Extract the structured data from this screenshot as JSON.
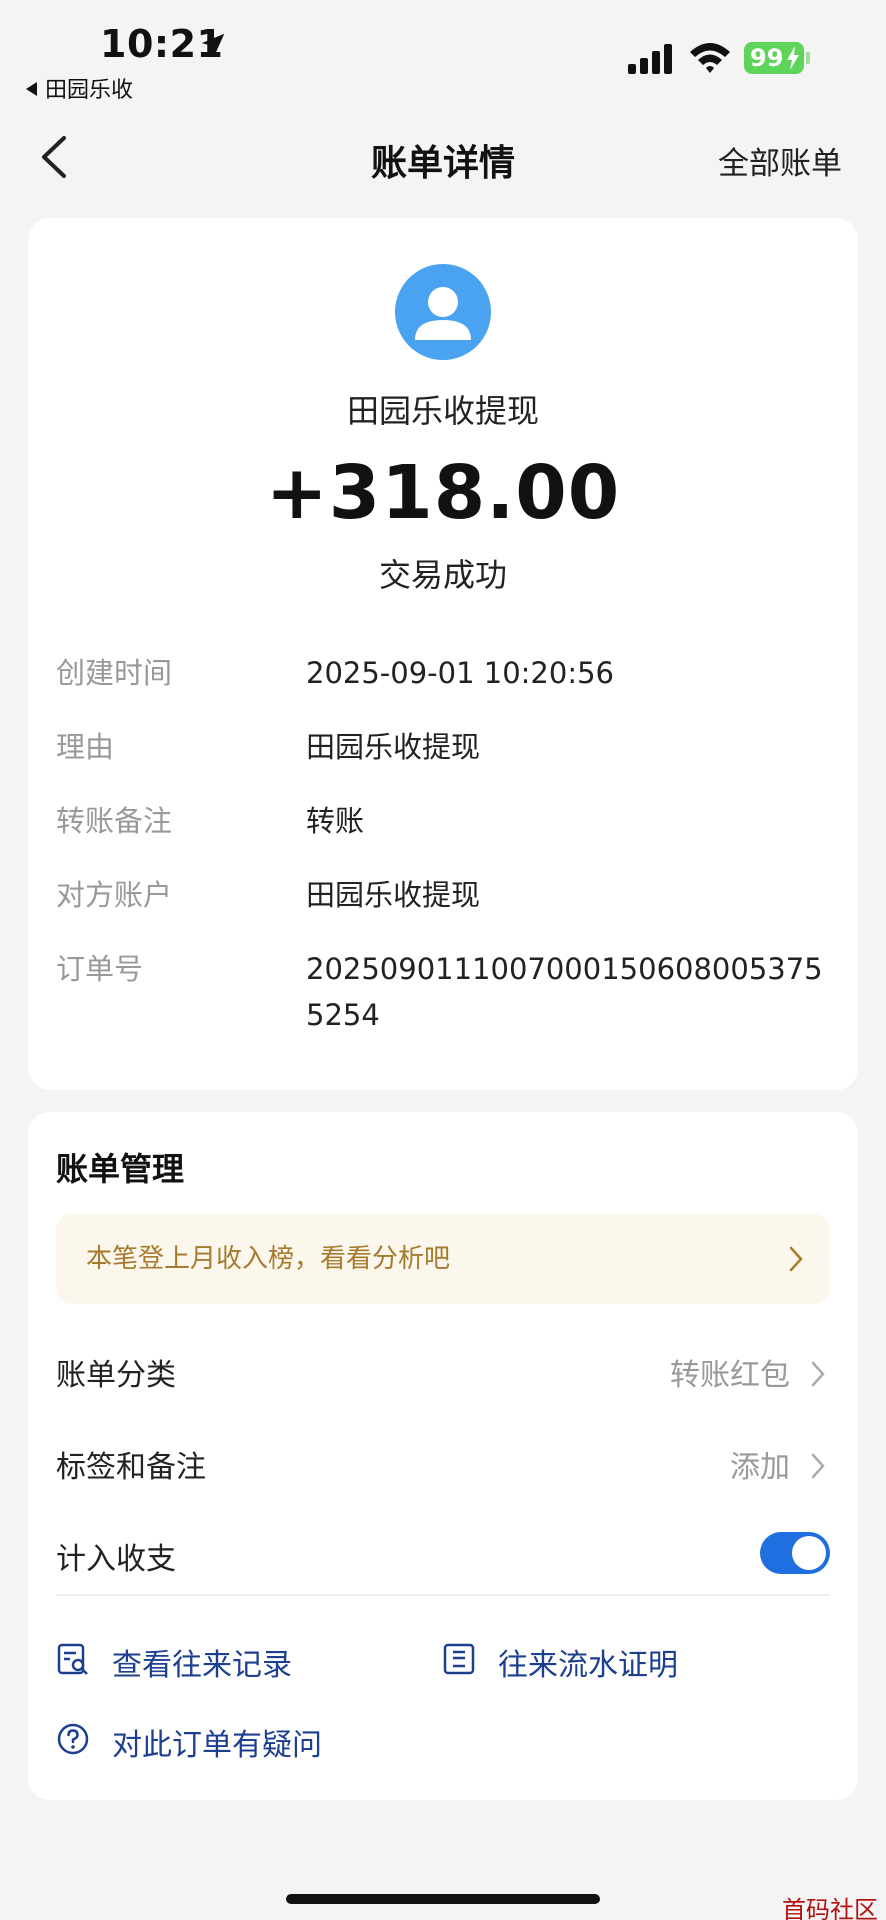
{
  "status_bar": {
    "time": "10:21",
    "back_app": "田园乐收",
    "battery": "99"
  },
  "nav": {
    "title": "账单详情",
    "right_link": "全部账单"
  },
  "transaction": {
    "payee": "田园乐收提现",
    "amount": "+318.00",
    "status": "交易成功",
    "details": [
      {
        "label": "创建时间",
        "value": "2025-09-01 10:20:56"
      },
      {
        "label": "理由",
        "value": "田园乐收提现"
      },
      {
        "label": "转账备注",
        "value": "转账"
      },
      {
        "label": "对方账户",
        "value": "田园乐收提现"
      },
      {
        "label": "订单号",
        "value": "20250901110070001506080053755254"
      }
    ]
  },
  "management": {
    "title": "账单管理",
    "promo": "本笔登上月收入榜，看看分析吧",
    "category_label": "账单分类",
    "category_value": "转账红包",
    "tags_label": "标签和备注",
    "tags_value": "添加",
    "count_label": "计入收支",
    "count_enabled": true,
    "link_records": "查看往来记录",
    "link_proof": "往来流水证明",
    "link_question": "对此订单有疑问"
  },
  "watermark": "首码社区",
  "colors": {
    "accent": "#1f6fe0",
    "avatar": "#4aa3f0",
    "battery": "#5fd45a",
    "link": "#1d3f8f",
    "promo_text": "#a77b2e"
  }
}
